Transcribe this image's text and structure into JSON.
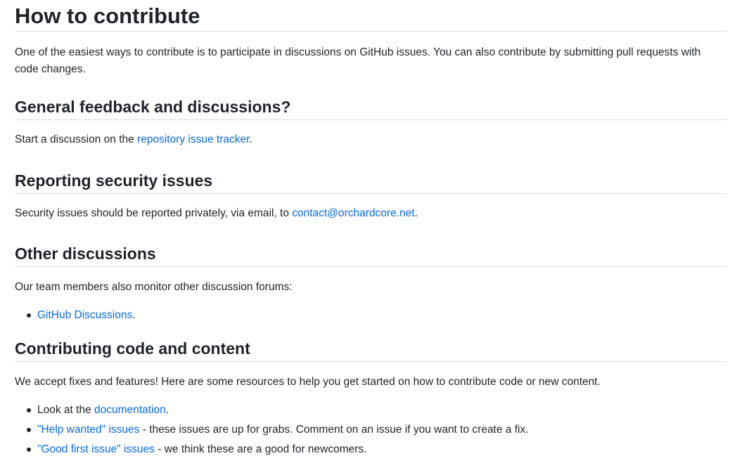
{
  "title": "How to contribute",
  "intro": "One of the easiest ways to contribute is to participate in discussions on GitHub issues. You can also contribute by submitting pull requests with code changes.",
  "general": {
    "heading": "General feedback and discussions?",
    "text_before": "Start a discussion on the ",
    "link": "repository issue tracker",
    "text_after": "."
  },
  "security": {
    "heading": "Reporting security issues",
    "text_before": "Security issues should be reported privately, via email, to ",
    "link": "contact@orchardcore.net",
    "text_after": "."
  },
  "other": {
    "heading": "Other discussions",
    "text": "Our team members also monitor other discussion forums:",
    "items": [
      {
        "link": "GitHub Discussions",
        "text": "."
      }
    ]
  },
  "code": {
    "heading": "Contributing code and content",
    "text": "We accept fixes and features! Here are some resources to help you get started on how to contribute code or new content.",
    "items": [
      {
        "before": "Look at the ",
        "link": "documentation",
        "after": "."
      },
      {
        "before": "",
        "link": "\"Help wanted\" issues",
        "after": " - these issues are up for grabs. Comment on an issue if you want to create a fix."
      },
      {
        "before": "",
        "link": "\"Good first issue\" issues",
        "after": " - we think these are a good for newcomers."
      }
    ]
  }
}
